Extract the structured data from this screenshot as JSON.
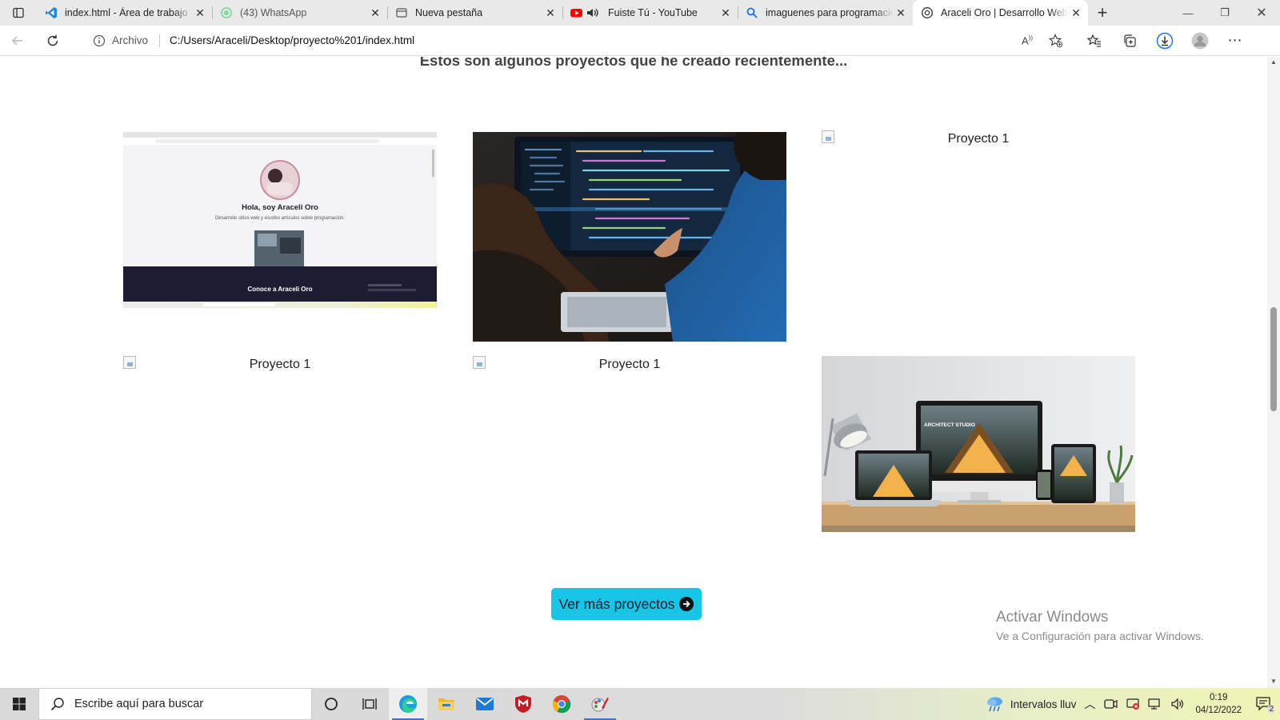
{
  "browser": {
    "tabs": [
      {
        "title": "index.html - Área de trabajo - Visual Studio Code",
        "icon": "vscode-icon"
      },
      {
        "title": "(43) WhatsApp",
        "icon": "whatsapp-icon"
      },
      {
        "title": "Nueva pestaña",
        "icon": "newtab-page-icon"
      },
      {
        "title": "Fuiste Tú - YouTube",
        "icon": "youtube-icon"
      },
      {
        "title": "imaguenes para programacion - Buscar",
        "icon": "search-icon"
      },
      {
        "title": "Araceli Oro | Desarrollo Web Front-End",
        "icon": "globe-icon",
        "active": true
      }
    ],
    "site_label": "Archivo",
    "url": "C:/Users/Araceli/Desktop/proyecto%201/index.html"
  },
  "page": {
    "subtitle": "Estos son algunos proyectos que he creado recientemente...",
    "thumb1": {
      "greeting": "Hola, soy Araceli Oro",
      "tagline": "Desarrollo sitios web y escribo artículos sobre programación.",
      "banner": "Conoce a Araceli Oro"
    },
    "mockup_brand": "ARCHITECT STUDIO",
    "broken_alt": "Proyecto 1",
    "cta_label": "Ver más proyectos",
    "watermark": {
      "title": "Activar Windows",
      "subtitle": "Ve a Configuración para activar Windows."
    }
  },
  "taskbar": {
    "search_placeholder": "Escribe aquí para buscar",
    "weather": "Intervalos lluv",
    "time": "0:19",
    "date": "04/12/2022",
    "notification_count": "2"
  },
  "colors": {
    "accent_button": "#17c5e6",
    "tab_bar": "#e9e9e9",
    "heading_text": "#444444"
  }
}
